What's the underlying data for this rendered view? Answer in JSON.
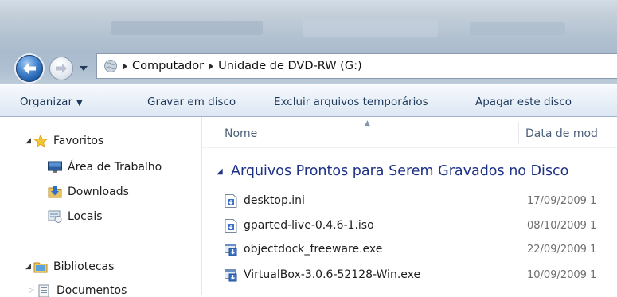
{
  "address_bar": {
    "breadcrumbs": [
      "Computador",
      "Unidade de DVD-RW (G:)"
    ]
  },
  "toolbar": {
    "organize_label": "Organizar",
    "burn_label": "Gravar em disco",
    "delete_temp_label": "Excluir arquivos temporários",
    "erase_label": "Apagar este disco"
  },
  "nav_pane": {
    "favorites": "Favoritos",
    "favorite_items": [
      "Área de Trabalho",
      "Downloads",
      "Locais"
    ],
    "libraries": "Bibliotecas",
    "library_items": [
      "Documentos"
    ]
  },
  "columns": {
    "name": "Nome",
    "date": "Data de mod"
  },
  "group": {
    "title": "Arquivos Prontos para Serem Gravados no Disco"
  },
  "files": [
    {
      "name": "desktop.ini",
      "date": "17/09/2009 1",
      "icon": "ini-file-icon"
    },
    {
      "name": "gparted-live-0.4.6-1.iso",
      "date": "08/10/2009 1",
      "icon": "iso-file-icon"
    },
    {
      "name": "objectdock_freeware.exe",
      "date": "22/09/2009 1",
      "icon": "exe-file-icon"
    },
    {
      "name": "VirtualBox-3.0.6-52128-Win.exe",
      "date": "10/09/2009 1",
      "icon": "exe-file-icon"
    }
  ],
  "colors": {
    "group_header": "#1e3287",
    "column_header": "#4c607a",
    "toolbar_text": "#1e395b"
  }
}
